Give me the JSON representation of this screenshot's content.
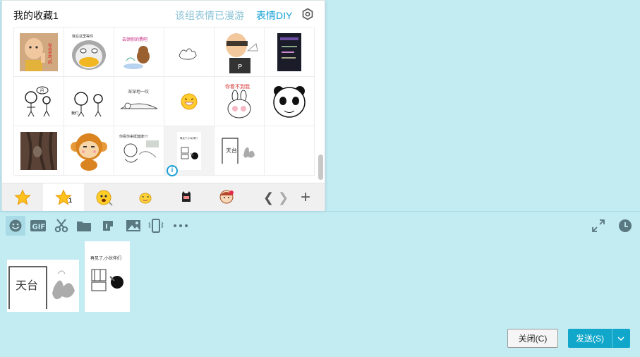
{
  "popup": {
    "title": "我的收藏1",
    "roam_label": "该组表情已漫游",
    "diy_label": "表情DIY",
    "settings_icon": "hexagon-settings-icon"
  },
  "stickers": [
    {
      "name": "sticker-baby-pointing",
      "caption": "你会生气的"
    },
    {
      "name": "sticker-penguin-duck",
      "caption": "我在这里等你"
    },
    {
      "name": "sticker-bear-flower",
      "caption": "去领你的票吧"
    },
    {
      "name": "sticker-doodle-hand",
      "caption": ""
    },
    {
      "name": "sticker-man-bald-p",
      "caption": "P"
    },
    {
      "name": "sticker-dark-scene",
      "caption": ""
    },
    {
      "name": "sticker-stickmen-1",
      "caption": "问"
    },
    {
      "name": "sticker-stickmen-2",
      "caption": "我们"
    },
    {
      "name": "sticker-mushroom-lie",
      "caption": "深深地一叹"
    },
    {
      "name": "sticker-smiley-yellow",
      "caption": ""
    },
    {
      "name": "sticker-rabbit-cry",
      "caption": "你看不到我"
    },
    {
      "name": "sticker-panda-face",
      "caption": ""
    },
    {
      "name": "sticker-tree-bark",
      "caption": ""
    },
    {
      "name": "sticker-monkey",
      "caption": ""
    },
    {
      "name": "sticker-scribble-boy",
      "caption": "你看你来挺健康!!!"
    },
    {
      "name": "sticker-rooftop-small",
      "caption": "再见了,小伙伴们"
    },
    {
      "name": "sticker-tiantai",
      "caption": "天台"
    },
    {
      "name": "sticker-empty",
      "caption": ""
    }
  ],
  "tabs": [
    {
      "name": "tab-star",
      "icon": "star-icon"
    },
    {
      "name": "tab-my-favorites-1",
      "icon": "star-icon",
      "num": "1"
    },
    {
      "name": "tab-yellow-face",
      "icon": "yellow-face-icon"
    },
    {
      "name": "tab-smiley-small",
      "icon": "small-yellow-face-icon"
    },
    {
      "name": "tab-black-cat",
      "icon": "black-cat-icon"
    },
    {
      "name": "tab-girl-face",
      "icon": "girl-face-icon"
    }
  ],
  "toolbar": [
    {
      "name": "emoji-tool",
      "icon": "smiley-icon"
    },
    {
      "name": "gif-tool",
      "icon": "gif-icon",
      "label": "GIF"
    },
    {
      "name": "screenshot-tool",
      "icon": "scissors-icon"
    },
    {
      "name": "folder-tool",
      "icon": "folder-icon"
    },
    {
      "name": "music-tool",
      "icon": "music-icon"
    },
    {
      "name": "image-tool",
      "icon": "picture-icon"
    },
    {
      "name": "shake-tool",
      "icon": "shake-phone-icon"
    },
    {
      "name": "more-tool",
      "icon": "more-dots-icon"
    },
    {
      "name": "expand-tool",
      "icon": "expand-icon"
    },
    {
      "name": "history-tool",
      "icon": "clock-icon"
    }
  ],
  "input": {
    "image1_caption": "天台",
    "image2_caption": "再见了,小伙伴们"
  },
  "buttons": {
    "close": "关闭(C)",
    "send": "发送(S)"
  }
}
